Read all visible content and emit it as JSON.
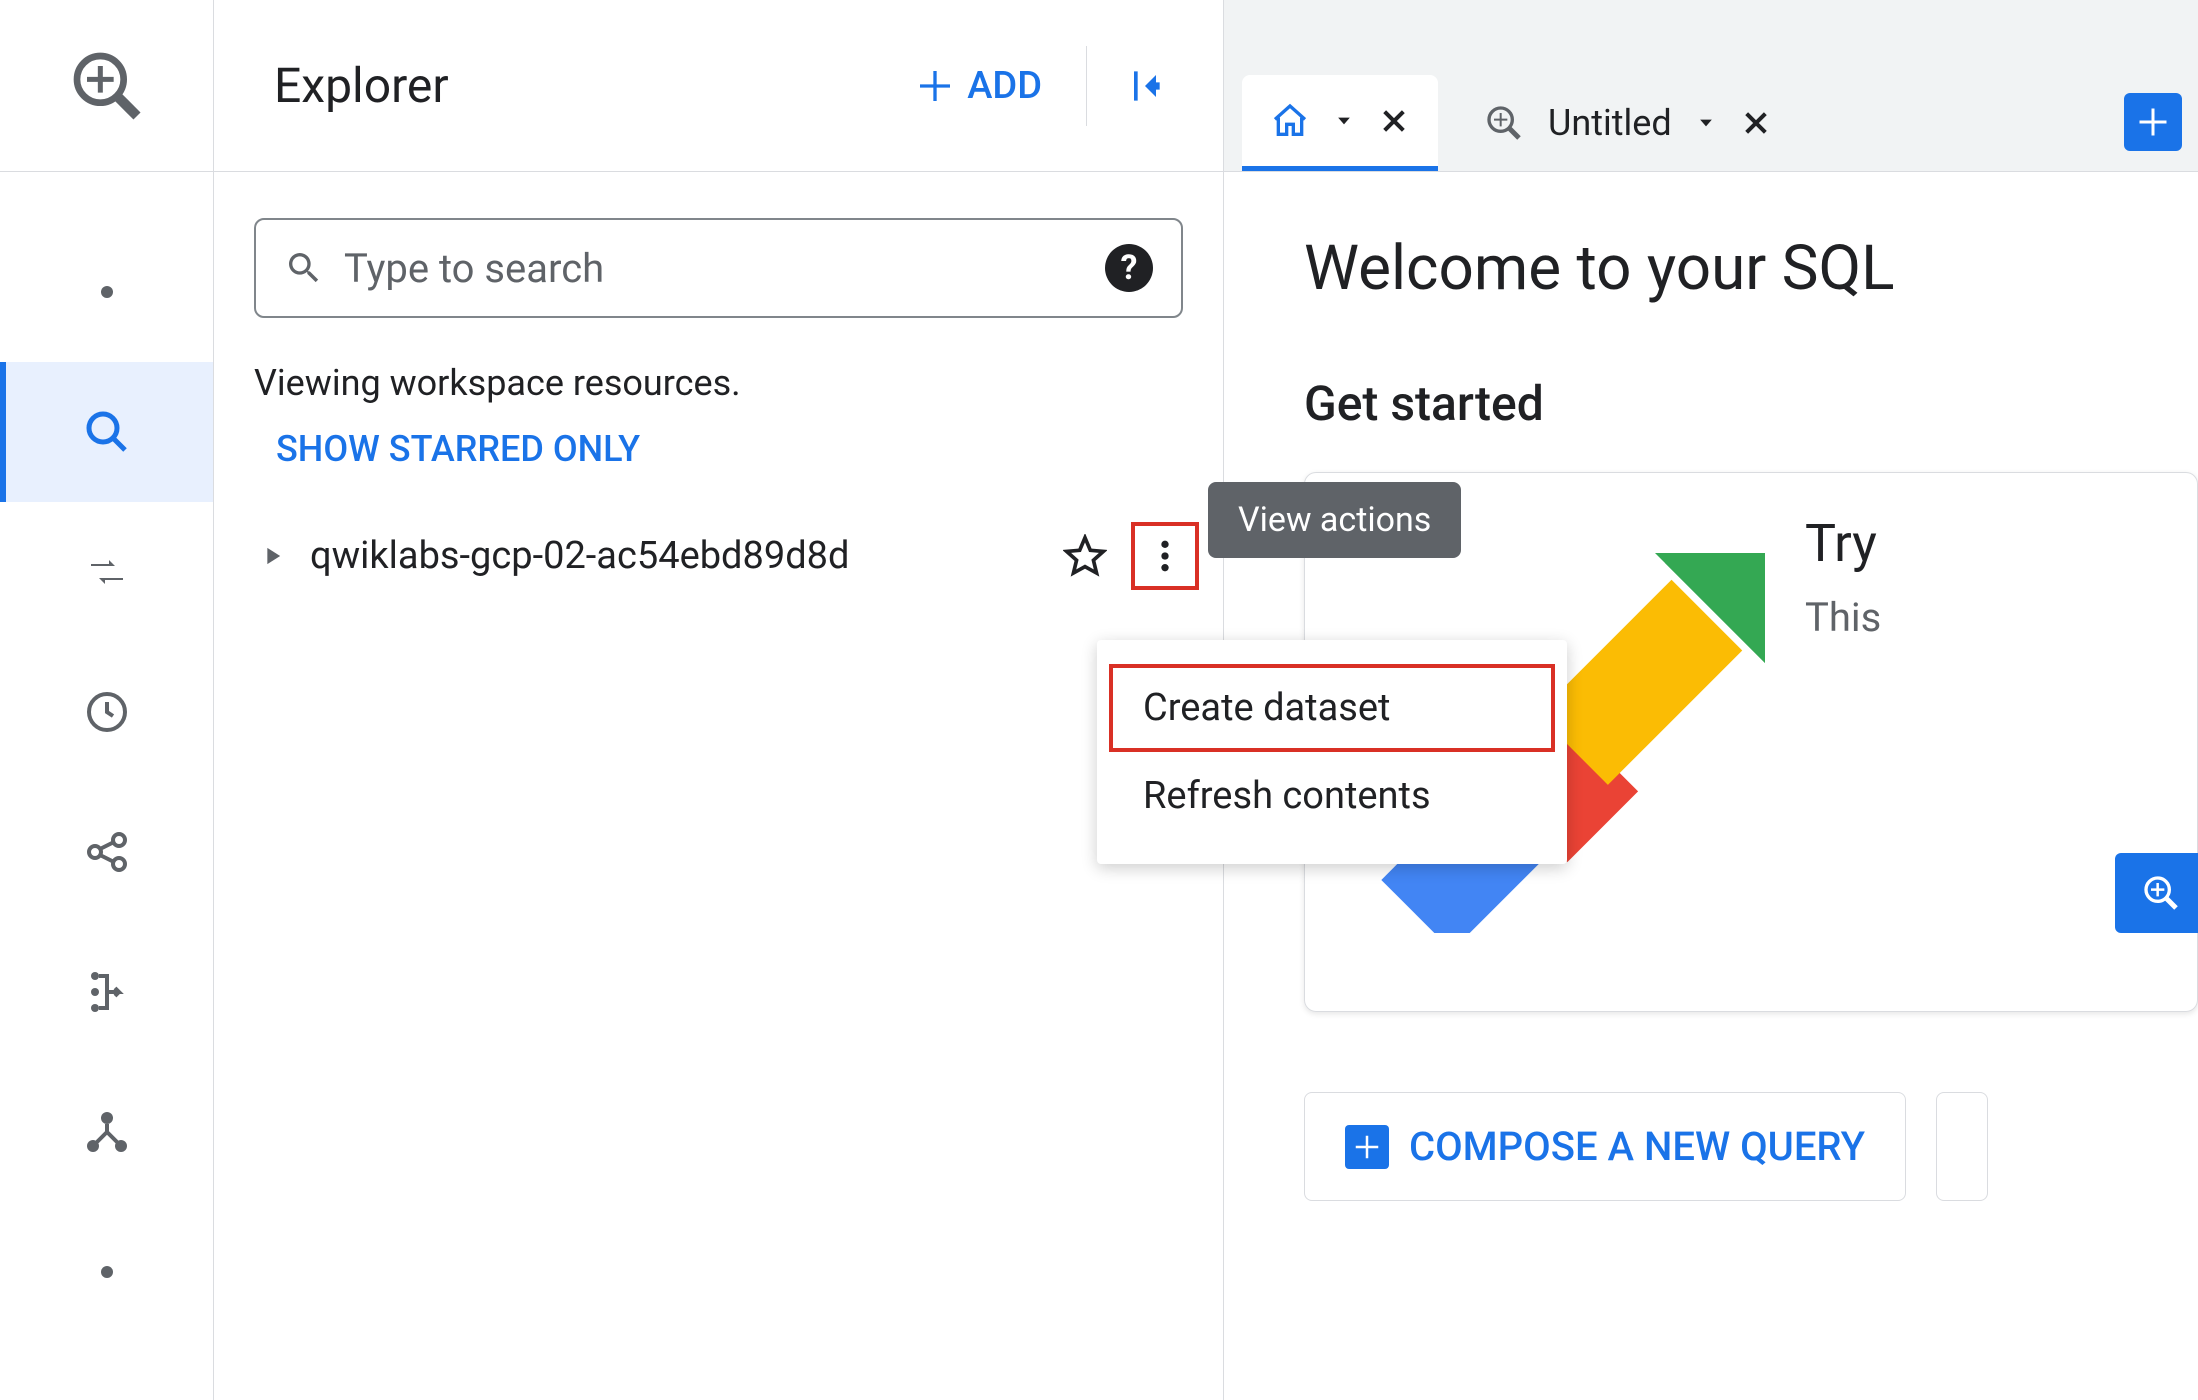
{
  "explorer": {
    "title": "Explorer",
    "add_label": "ADD",
    "search_placeholder": "Type to search",
    "resources_text": "Viewing workspace resources.",
    "starred_link": "SHOW STARRED ONLY",
    "project_name": "qwiklabs-gcp-02-ac54ebd89d8d"
  },
  "tooltip": {
    "view_actions": "View actions"
  },
  "context_menu": {
    "create_dataset": "Create dataset",
    "refresh_contents": "Refresh contents"
  },
  "tabs": {
    "untitled_label": "Untitled"
  },
  "main": {
    "welcome_title": "Welcome to your SQL",
    "get_started": "Get started",
    "card_title": "Try",
    "card_sub": "This",
    "compose_label": "COMPOSE A NEW QUERY"
  }
}
